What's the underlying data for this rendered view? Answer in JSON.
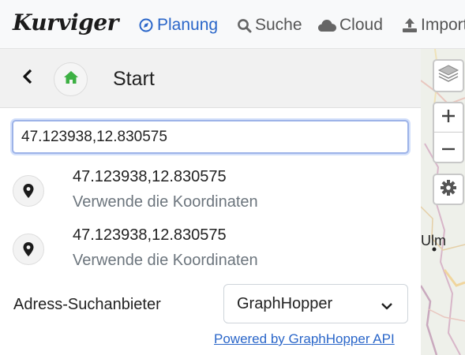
{
  "app": {
    "logo": "Kurviger"
  },
  "nav": {
    "items": [
      {
        "label": "Planung",
        "icon": "compass-icon",
        "active": true
      },
      {
        "label": "Suche",
        "icon": "search-icon",
        "active": false
      },
      {
        "label": "Cloud",
        "icon": "cloud-icon",
        "active": false
      },
      {
        "label": "Import",
        "icon": "upload-icon",
        "active": false
      }
    ]
  },
  "sidebar": {
    "title": "Start",
    "search": {
      "value": "47.123938,12.830575",
      "placeholder": ""
    },
    "results": [
      {
        "title": "47.123938,12.830575",
        "subtitle": "Verwende die Koordinaten",
        "icon": "map-marker-icon"
      },
      {
        "title": "47.123938,12.830575",
        "subtitle": "Verwende die Koordinaten",
        "icon": "map-marker-icon"
      }
    ],
    "provider": {
      "label": "Adress-Suchanbieter",
      "selected": "GraphHopper"
    },
    "powered_by": "Powered by GraphHopper API"
  },
  "map": {
    "city_label": "Ulm",
    "controls": [
      "layers-icon",
      "zoom-in-icon",
      "zoom-out-icon",
      "gear-icon"
    ]
  },
  "colors": {
    "accent": "#2a66c9",
    "home_green": "#3cb043",
    "header_bg": "#f8f9fa"
  }
}
